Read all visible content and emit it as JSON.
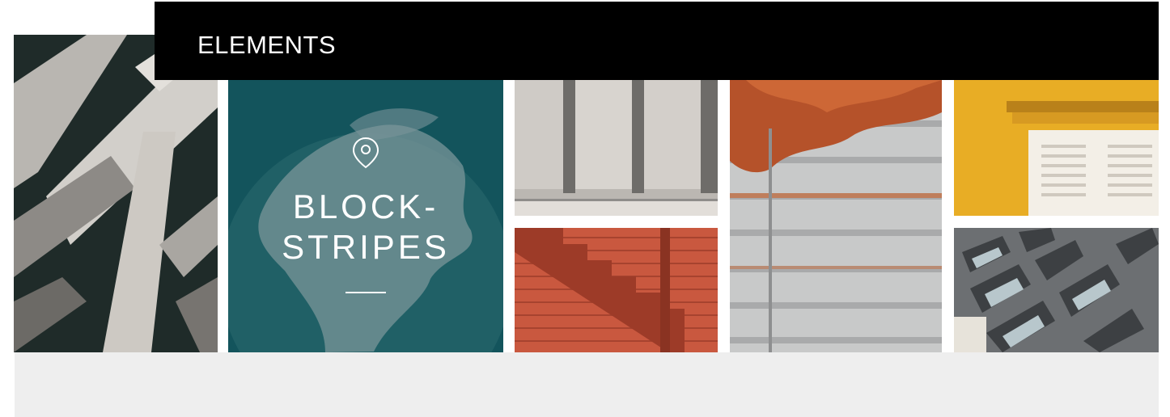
{
  "header": {
    "title": "ELEMENTS"
  },
  "feature": {
    "title_line1": "BLOCK-",
    "title_line2": "STRIPES",
    "icon": "map-pin-icon",
    "background": "#13545c"
  },
  "gallery": {
    "tiles": [
      {
        "name": "concrete-beams",
        "icon": "photo"
      },
      {
        "name": "classical-columns",
        "icon": "photo"
      },
      {
        "name": "orange-staircase",
        "icon": "photo"
      },
      {
        "name": "autumn-leaves-fence",
        "icon": "photo"
      },
      {
        "name": "yellow-wall-shutters",
        "icon": "photo"
      },
      {
        "name": "grey-building-facade",
        "icon": "photo"
      }
    ]
  },
  "colors": {
    "header_bg": "#000000",
    "accent": "#13545c",
    "footer_bg": "#eeeeee"
  }
}
